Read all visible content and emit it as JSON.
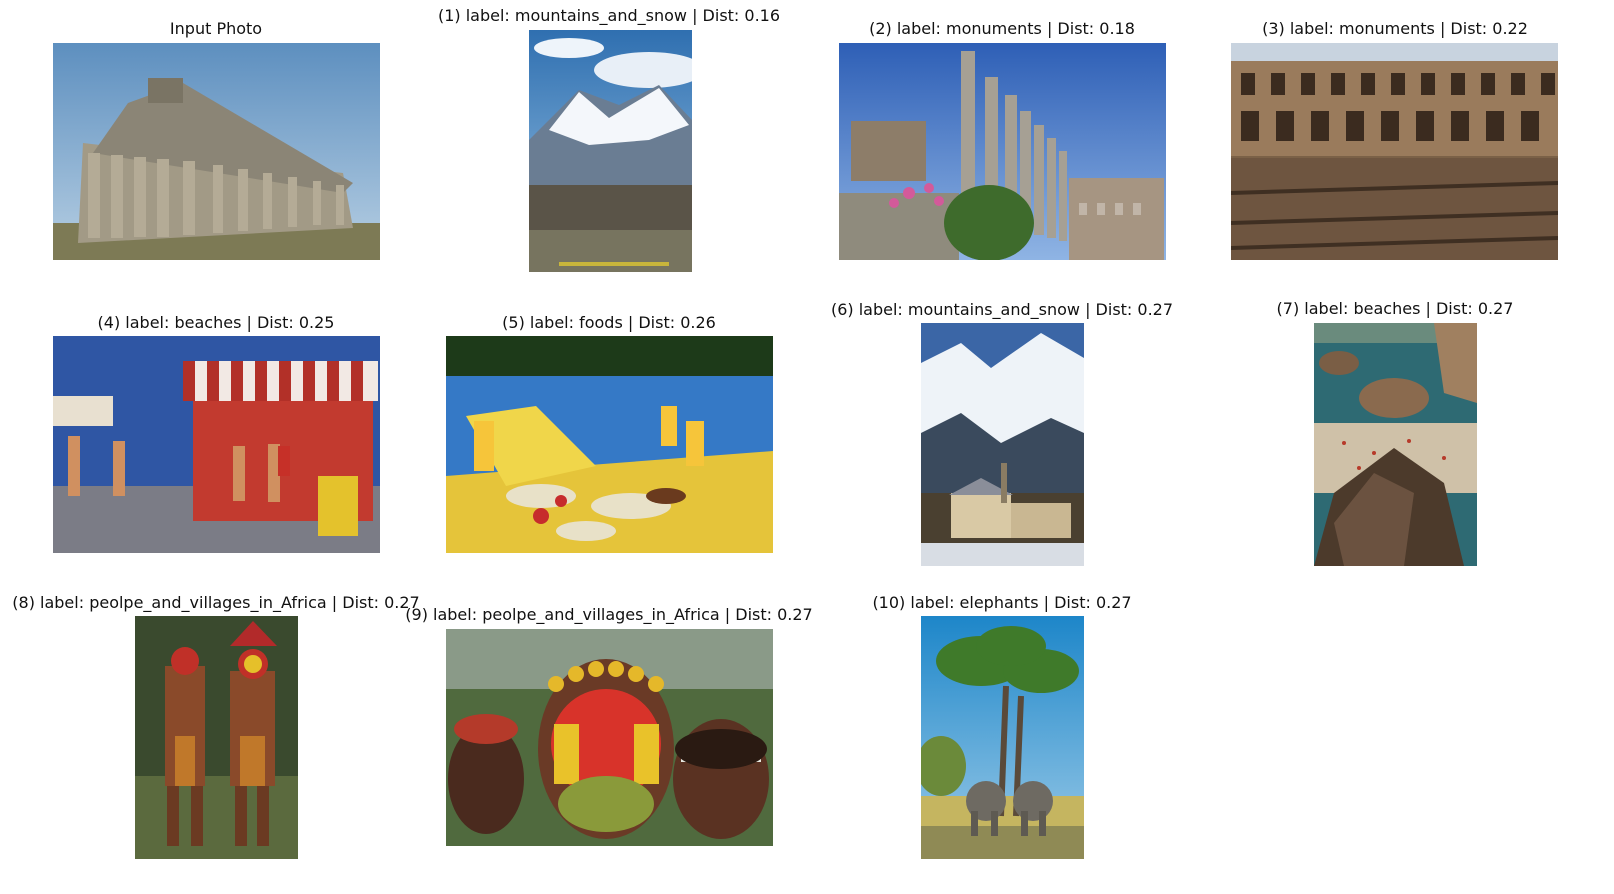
{
  "figure": {
    "panels": [
      {
        "title": "Input Photo",
        "subject": "greek-temple-ruins"
      },
      {
        "title": "(1) label: mountains_and_snow | Dist: 0.16",
        "subject": "snowy-mountain-under-clouds"
      },
      {
        "title": "(2) label: monuments | Dist: 0.18",
        "subject": "roman-columns-and-colosseum"
      },
      {
        "title": "(3) label: monuments | Dist: 0.22",
        "subject": "colosseum-interior"
      },
      {
        "title": "(4) label: beaches | Dist: 0.25",
        "subject": "seaside-kiosk-with-people"
      },
      {
        "title": "(5) label: foods | Dist: 0.26",
        "subject": "poolside-food-spread"
      },
      {
        "title": "(6) label: mountains_and_snow | Dist: 0.27",
        "subject": "alpine-village-and-peaks"
      },
      {
        "title": "(7) label: beaches | Dist: 0.27",
        "subject": "rocky-beach-with-bathers"
      },
      {
        "title": "(8) label: peolpe_and_villages_in_Africa | Dist: 0.27",
        "subject": "two-painted-tribesmen"
      },
      {
        "title": "(9) label: peolpe_and_villages_in_Africa | Dist: 0.27",
        "subject": "face-painted-men-closeup"
      },
      {
        "title": "(10) label: elephants | Dist: 0.27",
        "subject": "elephants-under-tree"
      }
    ]
  }
}
